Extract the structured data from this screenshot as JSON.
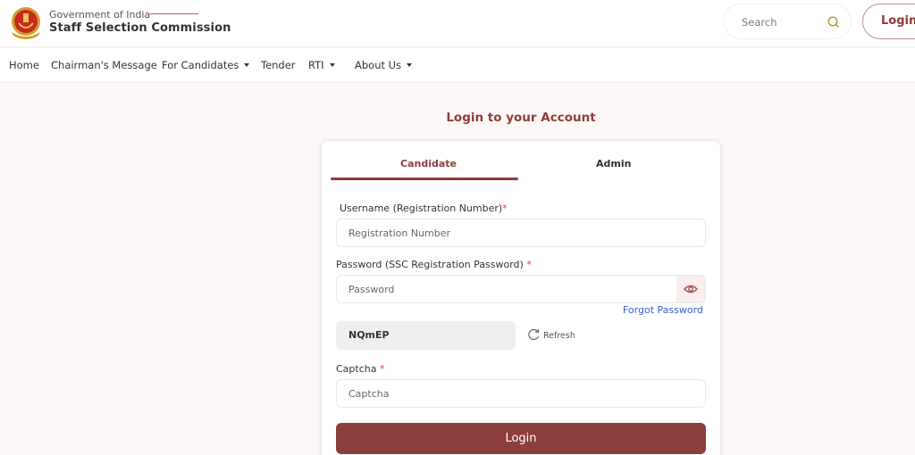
{
  "header": {
    "org_top": "Government of India",
    "org_main": "Staff Selection Commission",
    "search_placeholder": "Search",
    "login_label": "Login"
  },
  "nav": {
    "items": [
      {
        "label": "Home",
        "dropdown": false
      },
      {
        "label": "Chairman's Message",
        "dropdown": false
      },
      {
        "label": "For Candidates",
        "dropdown": true
      },
      {
        "label": "Tender",
        "dropdown": false
      },
      {
        "label": "RTI",
        "dropdown": true
      },
      {
        "label": "About Us",
        "dropdown": true
      }
    ]
  },
  "login": {
    "title": "Login to your Account",
    "tabs": [
      {
        "label": "Candidate",
        "active": true
      },
      {
        "label": "Admin",
        "active": false
      }
    ],
    "username_label": "Username (Registration Number)",
    "username_placeholder": "Registration Number",
    "password_label": "Password (SSC Registration Password) ",
    "password_placeholder": "Password",
    "required_mark": "*",
    "forgot_password": "Forgot Password",
    "captcha_value": "NQmEP",
    "refresh_label": "Refresh",
    "captcha_label": "Captcha ",
    "captcha_placeholder": "Captcha",
    "submit_label": "Login"
  },
  "colors": {
    "brand": "#8c3e3b",
    "link": "#2f5fd0",
    "required": "#e53935",
    "background": "#fdf8f7"
  }
}
